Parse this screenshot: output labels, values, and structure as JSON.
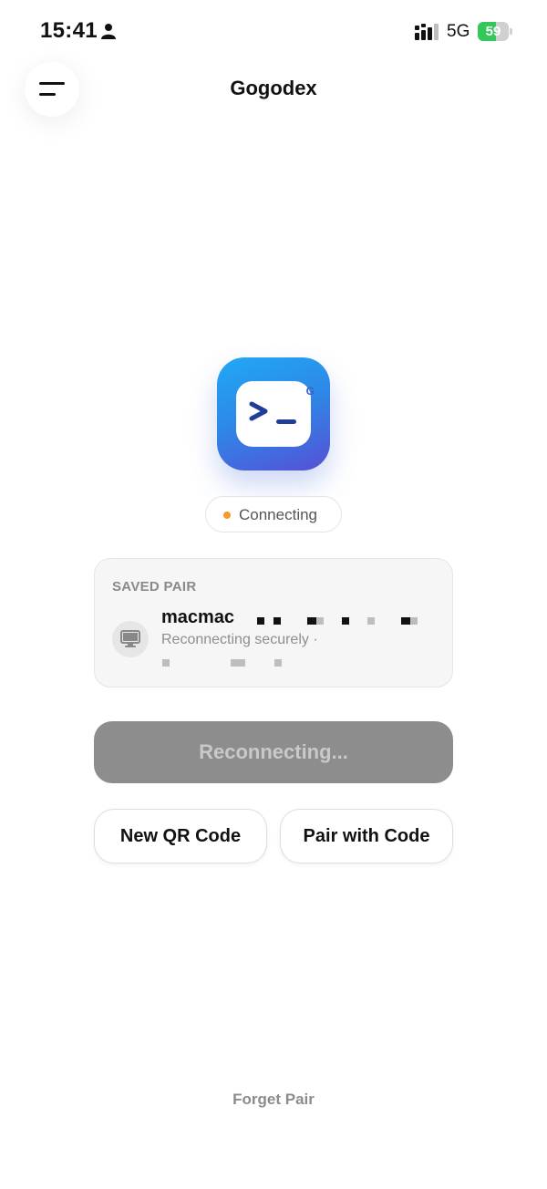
{
  "status_bar": {
    "time": "15:41",
    "network": "5G",
    "battery_percent": "59",
    "battery_level": 0.59,
    "battery_color": "#34c759",
    "icons": [
      "person-icon",
      "signal-icon",
      "charging-bolt-icon"
    ]
  },
  "header": {
    "title": "Gogodex",
    "menu_icon": "menu-icon"
  },
  "app_icon": {
    "prompt_symbol": ">_",
    "badge_letter": "G",
    "gradient": [
      "#22a8f5",
      "#5650d6"
    ]
  },
  "connection": {
    "status": "Connecting",
    "dot_color": "#f39a2b"
  },
  "saved_pair": {
    "label": "SAVED PAIR",
    "device_name": "macmac",
    "device_status": "Reconnecting securely ·",
    "device_icon": "monitor-icon"
  },
  "actions": {
    "primary_label": "Reconnecting...",
    "new_qr_label": "New QR Code",
    "pair_code_label": "Pair with Code",
    "forget_label": "Forget Pair"
  }
}
